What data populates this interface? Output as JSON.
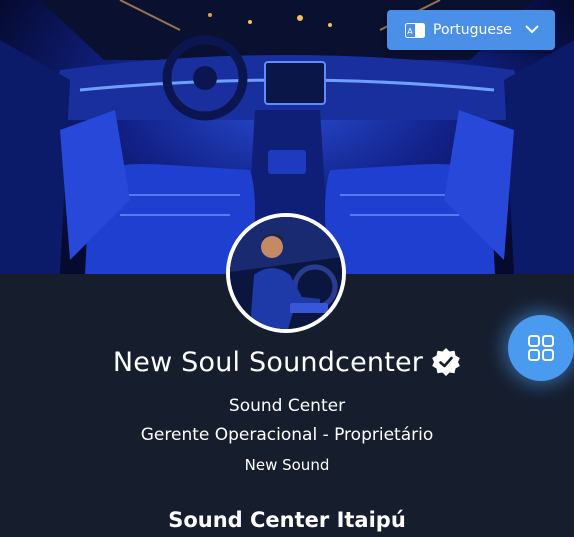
{
  "language_selector": {
    "label": "Portuguese",
    "icon": "translate-icon",
    "chevron": "chevron-down-icon"
  },
  "profile": {
    "name": "New Soul Soundcenter",
    "verified_icon": "verified-badge-icon",
    "company": "Sound Center",
    "role": "Gerente Operacional - Proprietário",
    "brand": "New Sound"
  },
  "section": {
    "title": "Sound Center Itaipú"
  },
  "fab": {
    "icon": "grid-menu-icon"
  },
  "colors": {
    "background": "#161e2e",
    "accent": "#4a90e8",
    "fab": "#4a9af0"
  }
}
